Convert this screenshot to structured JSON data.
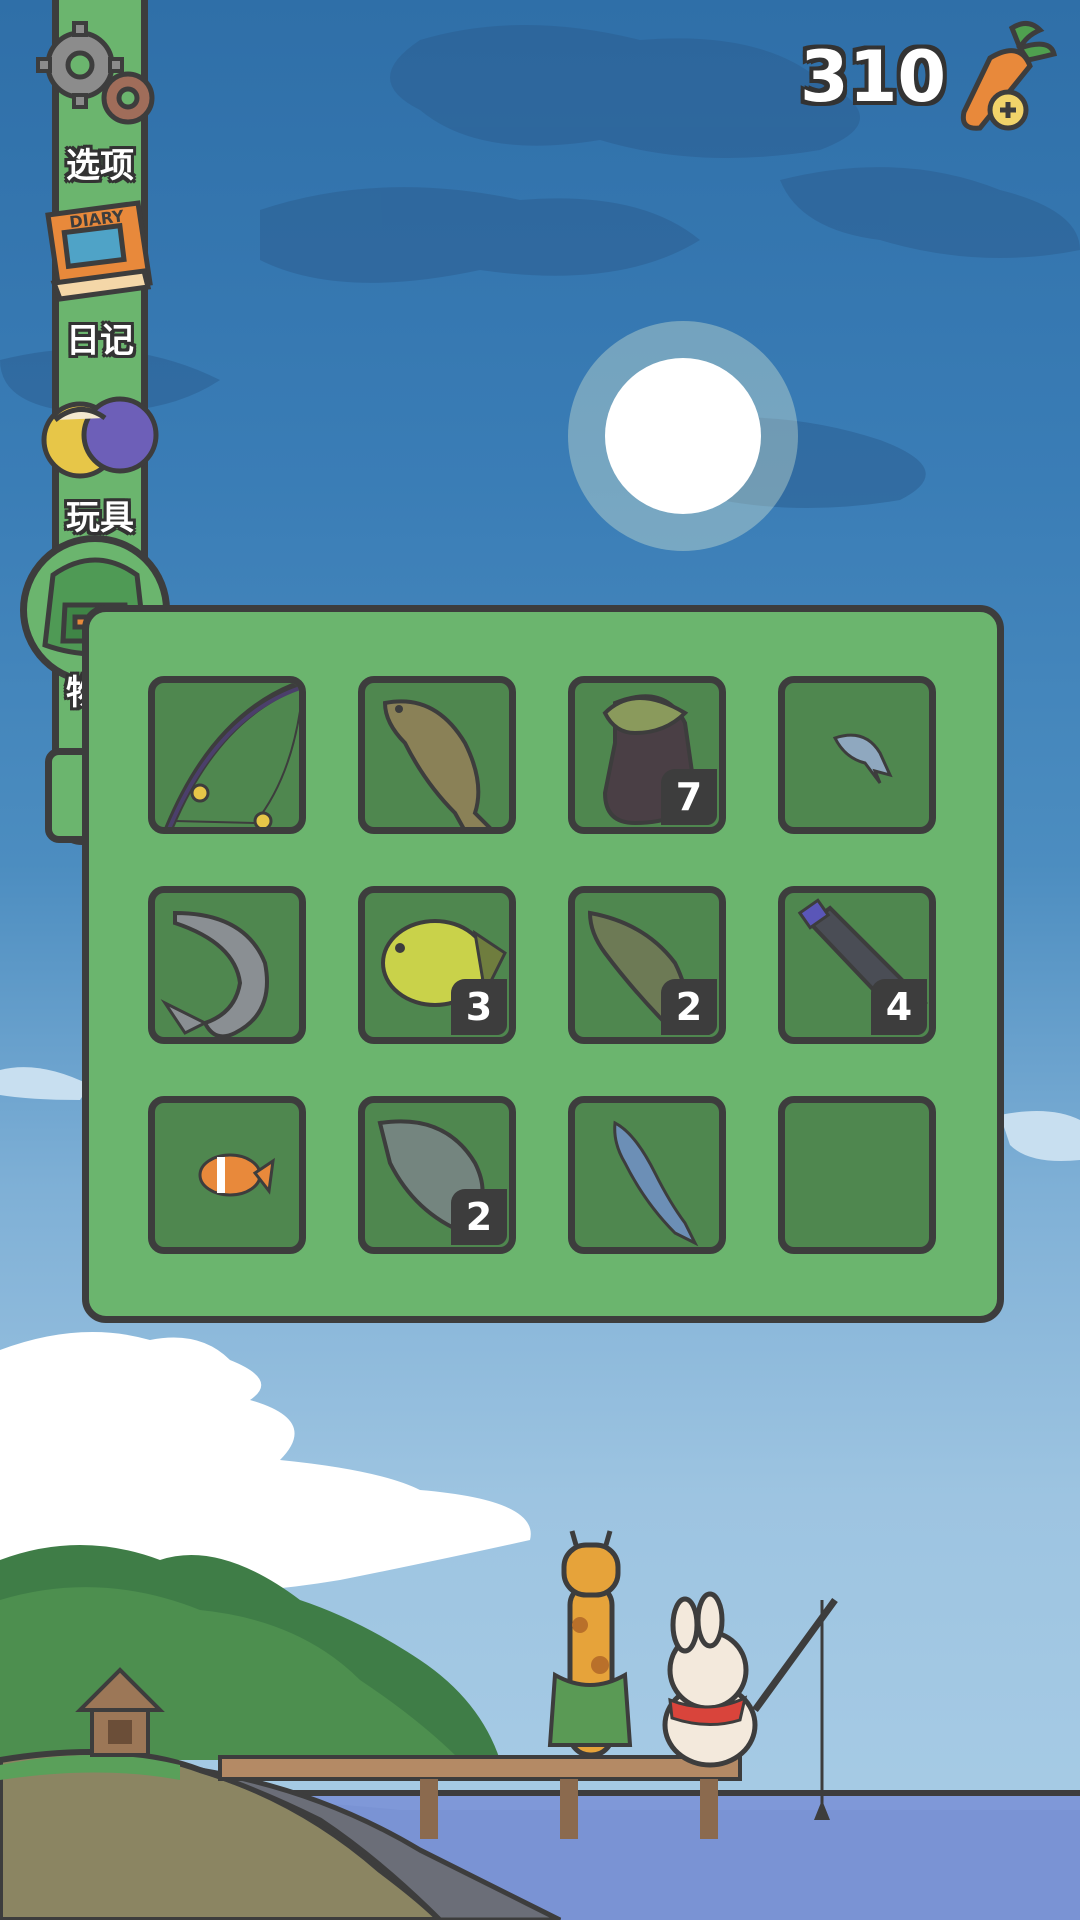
{
  "header": {
    "carrot_count": "310",
    "carrot_icon": "carrot-plus-icon"
  },
  "sidebar": {
    "items": [
      {
        "label": "选项",
        "icon": "gear-icon"
      },
      {
        "label": "日记",
        "icon": "diary-book-icon"
      },
      {
        "label": "玩具",
        "icon": "toy-balls-icon"
      },
      {
        "label": "物品",
        "icon": "backpack-icon",
        "active": true
      }
    ]
  },
  "inventory": {
    "slots": [
      {
        "item": "fishing-rod",
        "count": ""
      },
      {
        "item": "carp",
        "count": ""
      },
      {
        "item": "old-boot-with-weeds",
        "count": "7"
      },
      {
        "item": "small-fish",
        "count": ""
      },
      {
        "item": "sturgeon",
        "count": ""
      },
      {
        "item": "bluegill",
        "count": "3"
      },
      {
        "item": "largemouth-bass",
        "count": "2"
      },
      {
        "item": "plastic-bottle",
        "count": "4"
      },
      {
        "item": "clownfish",
        "count": ""
      },
      {
        "item": "tilapia",
        "count": "2"
      },
      {
        "item": "sardine",
        "count": ""
      },
      {
        "item": "empty",
        "count": ""
      }
    ]
  },
  "colors": {
    "panel_green": "#6bb56e",
    "slot_green": "#4f874f",
    "outline": "#3d3d3d",
    "sky_top": "#2f6fa8",
    "water": "#7f98d8"
  }
}
